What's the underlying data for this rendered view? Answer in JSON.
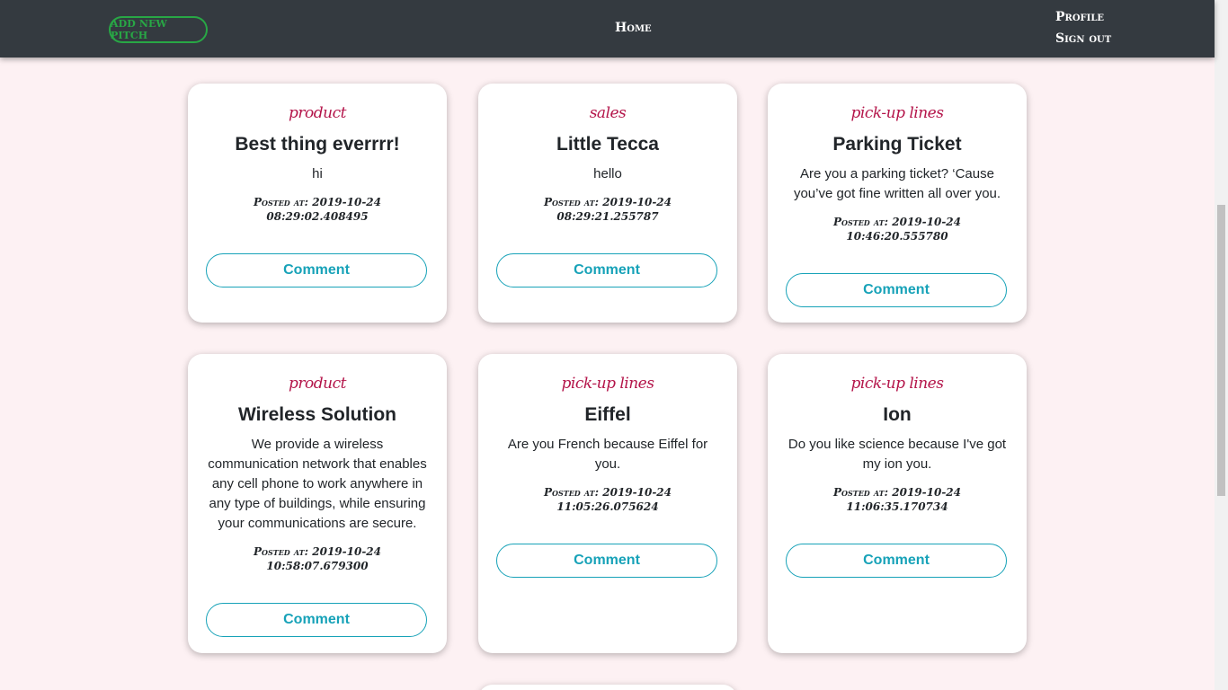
{
  "navbar": {
    "add_pitch_label": "ADD NEW PITCH",
    "home_label": "Home",
    "profile_label": "Profile",
    "signout_label": "Sign out"
  },
  "posted_prefix": "Posted at:",
  "comment_label": "Comment",
  "cards": [
    {
      "category": "product",
      "title": "Best thing everrrr!",
      "body": "hi",
      "posted": "2019-10-24 08:29:02.408495"
    },
    {
      "category": "sales",
      "title": "Little Tecca",
      "body": "hello",
      "posted": "2019-10-24 08:29:21.255787"
    },
    {
      "category": "pick-up lines",
      "title": "Parking Ticket",
      "body": "Are you a parking ticket? ‘Cause you’ve got fine written all over you.",
      "posted": "2019-10-24 10:46:20.555780"
    },
    {
      "category": "product",
      "title": "Wireless Solution",
      "body": "We provide a wireless communication network that enables any cell phone to work anywhere in any type of buildings, while ensuring your communications are secure.",
      "posted": "2019-10-24 10:58:07.679300"
    },
    {
      "category": "pick-up lines",
      "title": "Eiffel",
      "body": "Are you French because Eiffel for you.",
      "posted": "2019-10-24 11:05:26.075624"
    },
    {
      "category": "pick-up lines",
      "title": "Ion",
      "body": "Do you like science because I've got my ion you.",
      "posted": "2019-10-24 11:06:35.170734"
    }
  ],
  "colors": {
    "navbar_bg": "#343a40",
    "page_bg": "#fdf1f3",
    "category": "#b4154a",
    "comment_accent": "#17a2b8",
    "add_pitch_accent": "#28a745"
  }
}
